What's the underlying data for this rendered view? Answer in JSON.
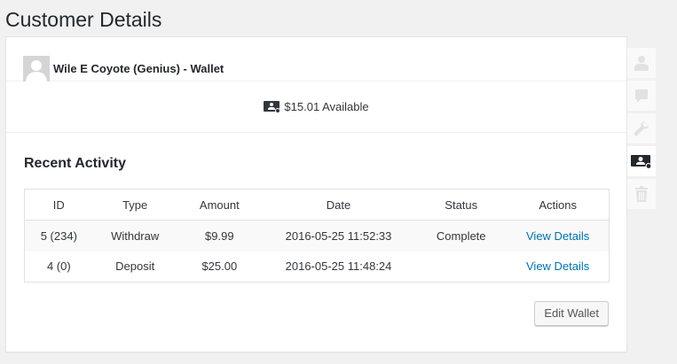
{
  "page": {
    "title": "Customer Details"
  },
  "customer": {
    "name": "Wile E Coyote (Genius) - Wallet"
  },
  "balance": {
    "text": "$15.01 Available"
  },
  "activity": {
    "title": "Recent Activity",
    "columns": [
      "ID",
      "Type",
      "Amount",
      "Date",
      "Status",
      "Actions"
    ],
    "rows": [
      {
        "id": "5 (234)",
        "type": "Withdraw",
        "amount": "$9.99",
        "date": "2016-05-25 11:52:33",
        "status": "Complete",
        "action": "View Details"
      },
      {
        "id": "4 (0)",
        "type": "Deposit",
        "amount": "$25.00",
        "date": "2016-05-25 11:48:24",
        "status": "",
        "action": "View Details"
      }
    ]
  },
  "buttons": {
    "edit_wallet": "Edit Wallet"
  },
  "tabs": [
    {
      "icon": "user-icon"
    },
    {
      "icon": "comment-icon"
    },
    {
      "icon": "wrench-icon"
    },
    {
      "icon": "wallet-icon",
      "active": true
    },
    {
      "icon": "trash-icon"
    }
  ],
  "colors": {
    "link": "#0073aa",
    "icon_muted": "#e2e2e2",
    "icon_active": "#23282d"
  }
}
